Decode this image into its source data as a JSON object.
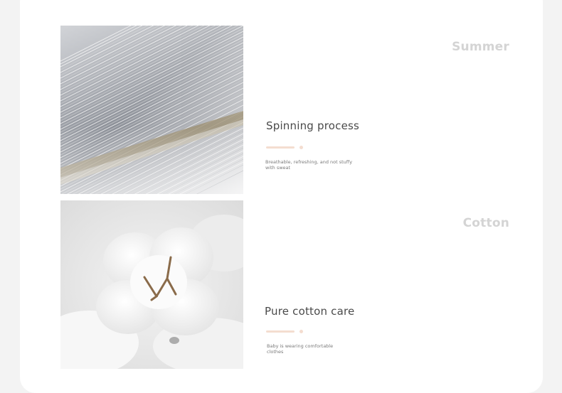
{
  "sections": [
    {
      "watermark": "Summer",
      "title": "Spinning process",
      "caption": "Breathable, refreshing, and not stuffy with sweat",
      "image": "loom-threads-photo"
    },
    {
      "watermark": "Cotton",
      "title": "Pure cotton care",
      "caption": "Baby is wearing comfortable clothes",
      "image": "cotton-boll-photo"
    }
  ],
  "colors": {
    "page_background": "#f3f3f3",
    "card_background": "#ffffff",
    "accent": "#f4ddd0",
    "watermark": "#d4d4d4",
    "heading": "#4a4a4a"
  }
}
